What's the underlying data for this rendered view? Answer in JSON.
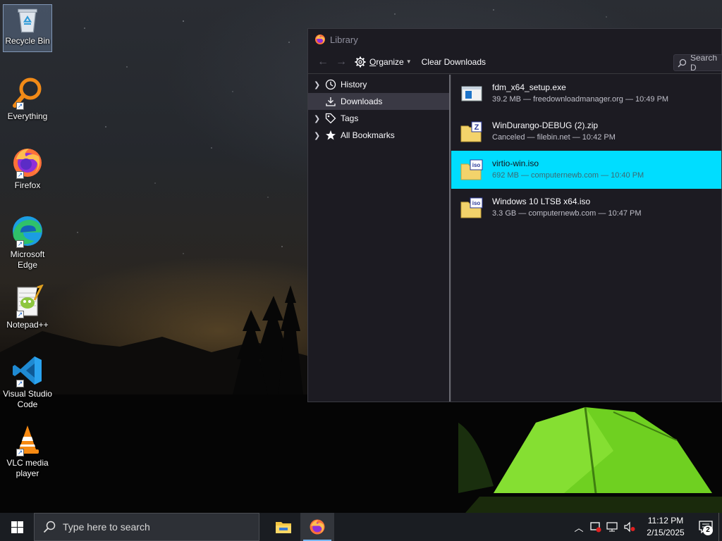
{
  "desktop": {
    "icons": [
      {
        "label": "Recycle Bin",
        "icon": "recycle-bin-icon"
      },
      {
        "label": "Everything",
        "icon": "everything-search-icon"
      },
      {
        "label": "Firefox",
        "icon": "firefox-icon"
      },
      {
        "label": "Microsoft Edge",
        "icon": "edge-icon"
      },
      {
        "label": "Notepad++",
        "icon": "notepadpp-icon"
      },
      {
        "label": "Visual Studio Code",
        "icon": "vscode-icon"
      },
      {
        "label": "VLC media player",
        "icon": "vlc-icon"
      }
    ]
  },
  "library": {
    "title": "Library",
    "toolbar": {
      "back_icon": "back-arrow-icon",
      "forward_icon": "forward-arrow-icon",
      "organize_label": "Organize",
      "organize_accel": "O",
      "organize_rest": "rganize",
      "clear_label": "Clear Downloads",
      "search_placeholder": "Search D"
    },
    "tree": [
      {
        "label": "History",
        "icon": "clock-icon",
        "expandable": true
      },
      {
        "label": "Downloads",
        "icon": "download-icon",
        "expandable": false,
        "active": true
      },
      {
        "label": "Tags",
        "icon": "tag-icon",
        "expandable": true
      },
      {
        "label": "All Bookmarks",
        "icon": "star-icon",
        "expandable": true
      }
    ],
    "downloads": [
      {
        "name": "fdm_x64_setup.exe",
        "meta": "39.2 MB — freedownloadmanager.org — 10:49 PM",
        "icon": "exe-file-icon"
      },
      {
        "name": "WinDurango-DEBUG (2).zip",
        "meta": "Canceled — filebin.net — 10:42 PM",
        "icon": "zip-file-icon"
      },
      {
        "name": "virtio-win.iso",
        "meta": "692 MB — computernewb.com — 10:40 PM",
        "icon": "iso-file-icon",
        "selected": true
      },
      {
        "name": "Windows 10 LTSB x64.iso",
        "meta": "3.3 GB — computernewb.com — 10:47 PM",
        "icon": "iso-file-icon"
      }
    ]
  },
  "taskbar": {
    "search_placeholder": "Type here to search",
    "time": "11:12 PM",
    "date": "2/15/2025",
    "notification_count": "2"
  },
  "colors": {
    "selection": "#00ddff",
    "window_bg": "#1c1b22",
    "taskbar_bg": "#1a1d22"
  }
}
